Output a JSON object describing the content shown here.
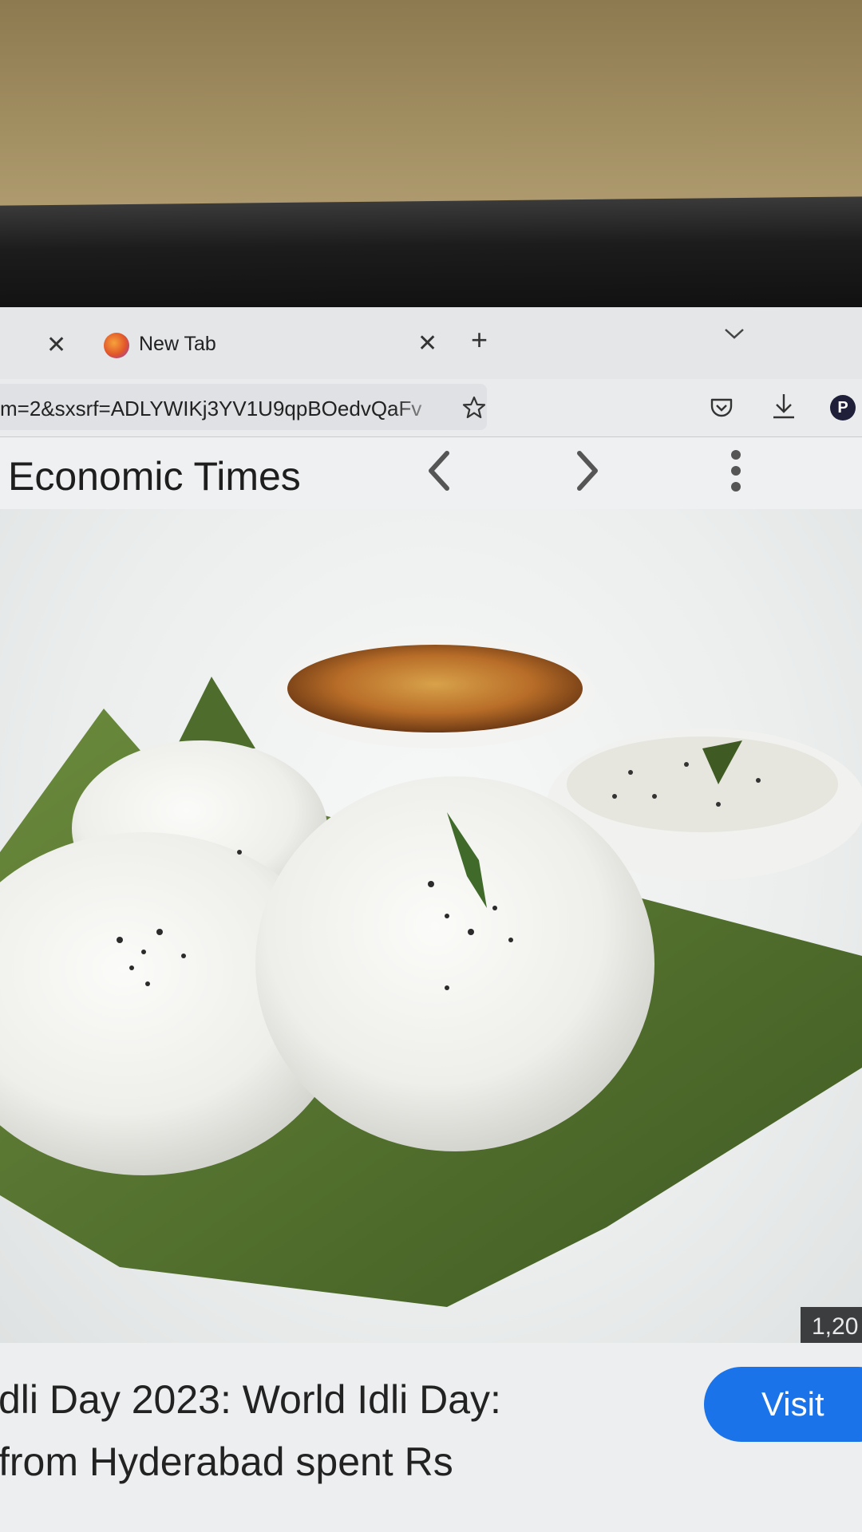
{
  "browser": {
    "tabs": [
      {
        "title": "New Tab"
      }
    ],
    "address_bar": {
      "url": "m=2&sxsrf=ADLYWIKj3YV1U9qpBOedvQaFv"
    },
    "toolbar": {
      "profile_initial": "P"
    },
    "icons": [
      "close-icon",
      "firefox-favicon",
      "plus-icon",
      "chevron-down-icon",
      "star-icon",
      "pocket-icon",
      "download-icon",
      "profile-avatar"
    ]
  },
  "viewer": {
    "source": "Economic Times",
    "image": {
      "alt": "idli-plate",
      "dimensions_badge": "1,20"
    },
    "headline": "dli Day 2023: World Idli Day:",
    "subheadline": "from Hyderabad spent Rs",
    "visit_label": "Visit",
    "icons": [
      "chevron-left-icon",
      "chevron-right-icon",
      "more-vertical-icon"
    ]
  },
  "colors": {
    "accent": "#1a73e8",
    "badge_bg": "#3b3d3f"
  }
}
